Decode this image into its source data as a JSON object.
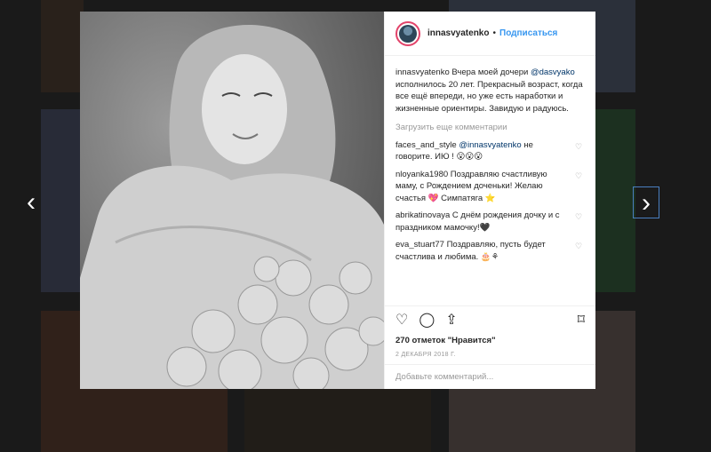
{
  "post": {
    "username": "innasvyatenko",
    "separator": "•",
    "follow_label": "Подписаться",
    "caption": {
      "author": "innasvyatenko",
      "text_before": " Вчера моей дочери ",
      "mention": "@dasvyako",
      "text_after": " исполнилось 20 лет. Прекрасный возраст, когда все ещё впереди, но уже есть наработки и жизненные ориентиры. Завидую и радуюсь."
    },
    "load_more_label": "Загрузить еще комментарии",
    "comments": [
      {
        "author": "faces_and_style",
        "mention": "@innasvyatenko",
        "text": " не говорите. ИЮ ! 😮😮😮"
      },
      {
        "author": "nloyanka1980",
        "mention": "",
        "text": " Поздравляю счастливую маму, с Рождением доченьки! Желаю счастья 💖 Симпатяга ⭐"
      },
      {
        "author": "abrikatinovaya",
        "mention": "",
        "text": " С днём рождения дочку и с праздником мамочку!🖤"
      },
      {
        "author": "eva_stuart77",
        "mention": "",
        "text": " Поздравляю, пусть будет счастлива и любима. 🎂⚘"
      }
    ],
    "likes_label": "270 отметок \"Нравится\"",
    "date_label": "2 ДЕКАБРЯ 2018 Г.",
    "add_comment_placeholder": "Добавьте комментарий..."
  },
  "icons": {
    "nav_left": "chevron-left-icon",
    "nav_right": "chevron-right-icon",
    "like": "heart-icon",
    "comment": "comment-icon",
    "share": "share-icon",
    "save": "bookmark-icon"
  },
  "colors": {
    "follow": "#3897f0",
    "avatar_ring": "#e2436a",
    "mention": "#003569"
  }
}
